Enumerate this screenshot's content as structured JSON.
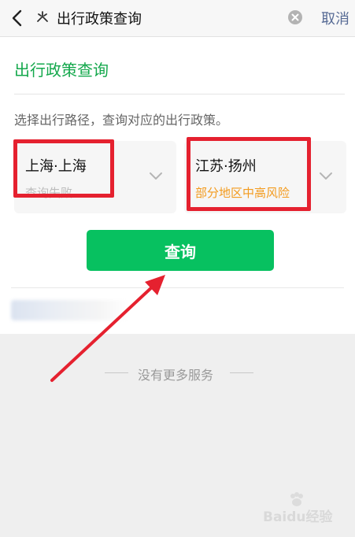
{
  "header": {
    "search_value": "出行政策查询",
    "cancel_label": "取消"
  },
  "card": {
    "title": "出行政策查询",
    "subtitle": "选择出行路径，查询对应的出行政策。",
    "from": {
      "city": "上海·上海",
      "status": "查询失败"
    },
    "to": {
      "city": "江苏·扬州",
      "status": "部分地区中高风险"
    },
    "query_label": "查询"
  },
  "footer": {
    "more_text": "没有更多服务"
  },
  "watermark": {
    "text": "Baidu经验"
  },
  "colors": {
    "accent_green": "#07c160",
    "title_green": "#14a84c",
    "warning_orange": "#f39b1e",
    "annotation_red": "#e5212f",
    "link_blue": "#576b95"
  }
}
